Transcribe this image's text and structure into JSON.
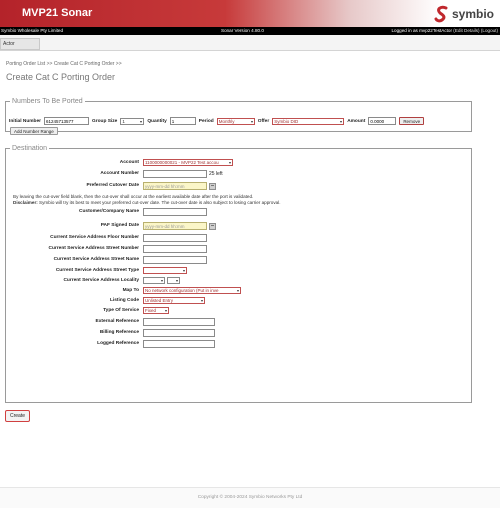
{
  "header": {
    "app_title": "MVP21 Sonar",
    "logo_text": "symbio",
    "brand_color": "#c0282d"
  },
  "infobar": {
    "company": "Symbio Wholesale Pty Limited",
    "version": "Sonar Version 4.80.0",
    "user_prefix": "Logged in as mvp22TestActor",
    "edit_details": "(Edit Details)",
    "logout": "(Logout)"
  },
  "tabs": {
    "actor": "Actor"
  },
  "breadcrumb": {
    "item1": "Porting Order List",
    "sep": ">>",
    "item2": "Create Cat C Porting Order"
  },
  "page_title": "Create Cat C Porting Order",
  "numbers": {
    "legend": "Numbers To Be Ported",
    "initial_number_label": "Initial Number",
    "initial_number_value": "61245713577",
    "group_size_label": "Group Size",
    "group_size_value": "1",
    "quantity_label": "Quantity",
    "quantity_value": "1",
    "period_label": "Period",
    "period_value": "Monthly",
    "offer_label": "Offer",
    "offer_value": "Symbio DID",
    "amount_label": "Amount",
    "amount_value": "0.0000",
    "remove_label": "Remove",
    "add_range_label": "Add Number Range"
  },
  "destination": {
    "legend": "Destination",
    "account_label": "Account",
    "account_value": "1100000000021 - MVP22 Test accou",
    "account_number_label": "Account Number",
    "account_number_suffix": "25 left",
    "cutover_label": "Preferred Cutover Date",
    "date_placeholder": "yyyy-mm-dd hh:mm",
    "note1": "By leaving the cut-over field blank, then the cut-over shall occur at the earliest available date after the port is validated.",
    "disclaimer_label": "Disclaimer:",
    "disclaimer_text": " Symbio will try its best to meet your preferred cut-over date. The cut-over date is also subject to losing carrier approval.",
    "customer_name_label": "Customer/Company Name",
    "paf_label": "PAF Signed Date",
    "floor_label": "Current Service Address Floor Number",
    "street_number_label": "Current Service Address Street Number",
    "street_name_label": "Current Service Address Street Name",
    "street_type_label": "Current Service Address Street Type",
    "locality_label": "Current Service Address Locality",
    "map_to_label": "Map To",
    "map_to_value": "No network configuration (Put in inve",
    "listing_code_label": "Listing Code",
    "listing_code_value": "Unlisted Entry",
    "type_of_service_label": "Type Of Service",
    "type_of_service_value": "Fixed",
    "external_ref_label": "External Reference",
    "billing_ref_label": "Billing Reference",
    "logged_ref_label": "Logged Reference"
  },
  "create_label": "Create",
  "footer": "Copyright © 2004-2024 Symbio Networks Pty Ltd"
}
